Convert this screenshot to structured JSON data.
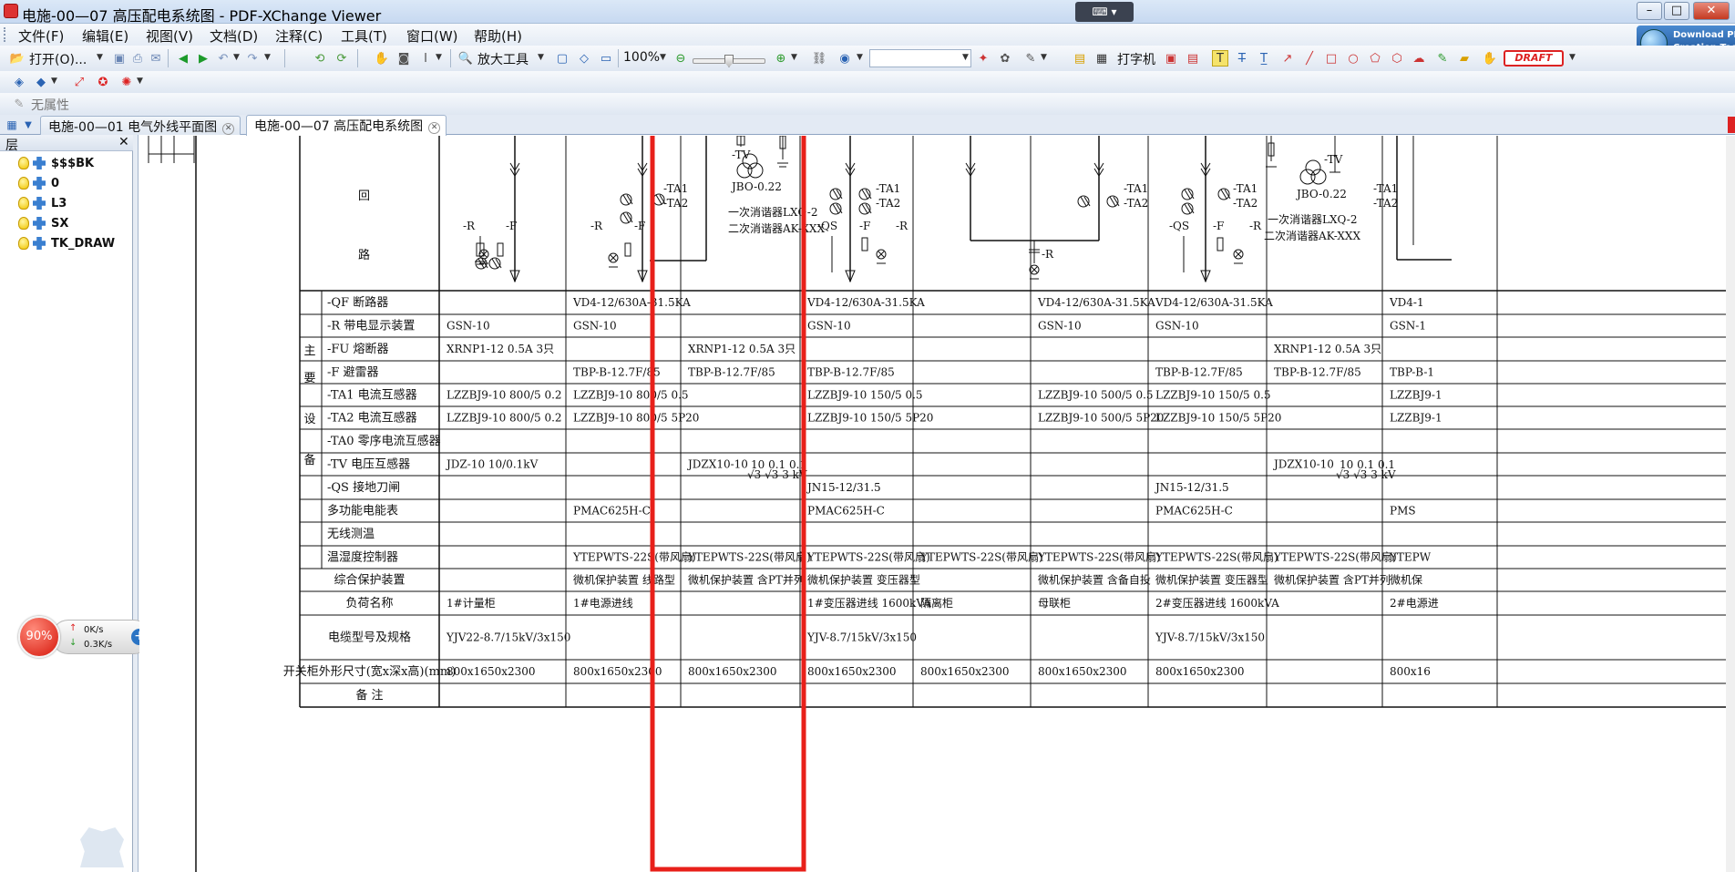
{
  "window": {
    "title": "电施-00—07 高压配电系统图 - PDF-XChange Viewer",
    "min": "–",
    "max": "□",
    "close": "✕"
  },
  "menu": [
    "文件(F)",
    "编辑(E)",
    "视图(V)",
    "文档(D)",
    "注释(C)",
    "工具(T)",
    "窗口(W)",
    "帮助(H)"
  ],
  "toolbar": {
    "open_label": "打开(O)...",
    "zoom_tool_label": "放大工具",
    "zoom_value": "100%",
    "typewriter_label": "打字机",
    "draft_stamp": "DRAFT"
  },
  "download_button": {
    "line1": "Download PD",
    "line2": "Creation Tool"
  },
  "props_label": "无属性",
  "tabs": [
    {
      "label": "电施-00—01 电气外线平面图",
      "active": false
    },
    {
      "label": "电施-00—07 高压配电系统图",
      "active": true
    }
  ],
  "layers_panel": {
    "title": "层",
    "items": [
      "$$$BK",
      "0",
      "L3",
      "SX",
      "TK_DRAW"
    ]
  },
  "net_widget": {
    "percent": "90%",
    "up": "0K/s",
    "down": "0.3K/s"
  },
  "drawing": {
    "huilu": [
      "回",
      "路"
    ],
    "main_equipment_label": [
      "主",
      "要",
      "设",
      "备"
    ],
    "row_labels": [
      "-QF  断路器",
      "-R   带电显示装置",
      "-FU  熔断器",
      "-F   避雷器",
      "-TA1 电流互感器",
      "-TA2 电流互感器",
      "-TA0 零序电流互感器",
      "-TV  电压互感器",
      "-QS  接地刀闸",
      "多功能电能表",
      "无线测温",
      "温湿度控制器",
      "综合保护装置",
      "负荷名称",
      "电缆型号及规格",
      "开关柜外形尺寸(宽x深x高)(mm)",
      "备    注"
    ],
    "columns": [
      [
        "",
        "GSN-10",
        "XRNP1-12 0.5A  3只",
        "",
        "LZZBJ9-10  800/5  0.2",
        "LZZBJ9-10  800/5  0.2",
        "",
        "JDZ-10        10/0.1kV",
        "",
        "",
        "",
        "",
        "",
        "1#计量柜",
        "YJV22-8.7/15kV/3x150",
        "800x1650x2300",
        ""
      ],
      [
        "VD4-12/630A-31.5KA",
        "GSN-10",
        "",
        "TBP-B-12.7F/85",
        "LZZBJ9-10  800/5  0.5",
        "LZZBJ9-10  800/5  5P20",
        "",
        "",
        "",
        "PMAC625H-C",
        "",
        "YTEPWTS-22S(带风扇)",
        "微机保护装置 线路型",
        "1#电源进线",
        "",
        "800x1650x2300",
        ""
      ],
      [
        "",
        "",
        "XRNP1-12 0.5A  3只",
        "TBP-B-12.7F/85",
        "",
        "",
        "",
        "JDZX10-10",
        "",
        "",
        "",
        "YTEPWTS-22S(带风扇)",
        "微机保护装置 含PT并列",
        "",
        "",
        "800x1650x2300",
        ""
      ],
      [
        "VD4-12/630A-31.5KA",
        "GSN-10",
        "",
        "TBP-B-12.7F/85",
        "LZZBJ9-10  150/5   0.5",
        "LZZBJ9-10  150/5  5P20",
        "",
        "",
        "JN15-12/31.5",
        "PMAC625H-C",
        "",
        "YTEPWTS-22S(带风扇)",
        "微机保护装置 变压器型",
        "1#变压器进线   1600kVA",
        "YJV-8.7/15kV/3x150",
        "800x1650x2300",
        ""
      ],
      [
        "",
        "",
        "",
        "",
        "",
        "",
        "",
        "",
        "",
        "",
        "",
        "YTEPWTS-22S(带风扇)",
        "",
        "隔离柜",
        "",
        "800x1650x2300",
        ""
      ],
      [
        "VD4-12/630A-31.5KA",
        "GSN-10",
        "",
        "",
        "LZZBJ9-10  500/5   0.5",
        "LZZBJ9-10  500/5  5P20",
        "",
        "",
        "",
        "",
        "",
        "YTEPWTS-22S(带风扇)",
        "微机保护装置 含备自投",
        "母联柜",
        "",
        "800x1650x2300",
        ""
      ],
      [
        "VD4-12/630A-31.5KA",
        "GSN-10",
        "",
        "TBP-B-12.7F/85",
        "LZZBJ9-10  150/5    0.5",
        "LZZBJ9-10  150/5   5P20",
        "",
        "",
        "JN15-12/31.5",
        "PMAC625H-C",
        "",
        "YTEPWTS-22S(带风扇)",
        "微机保护装置 变压器型",
        "2#变压器进线   1600kVA",
        "YJV-8.7/15kV/3x150",
        "800x1650x2300",
        ""
      ],
      [
        "",
        "",
        "XRNP1-12 0.5A  3只",
        "TBP-B-12.7F/85",
        "",
        "",
        "",
        "JDZX10-10",
        "",
        "",
        "",
        "YTEPWTS-22S(带风扇)",
        "微机保护装置 含PT并列",
        "",
        "",
        "",
        ""
      ],
      [
        "VD4-1",
        "GSN-1",
        "",
        "TBP-B-1",
        "LZZBJ9-1",
        "LZZBJ9-1",
        "",
        "",
        "",
        "PMS",
        "",
        "YTEPW",
        "微机保",
        "2#电源进",
        "",
        "800x16",
        ""
      ]
    ],
    "jdzx_ratio": "10  0.1  0.1",
    "jdzx_ratio_under": "√3  √3  3  kV",
    "symbol_labels": {
      "ta1": "-TA1",
      "ta2": "-TA2",
      "tv": "-TV",
      "qs": "-QS",
      "f": "-F",
      "r": "-R",
      "jbo": "JBO-0.22",
      "damper1": "一次消谐器LXQ-2",
      "damper2": "二次消谐器AK-XXX"
    },
    "highlight_color": "#e8201a"
  }
}
